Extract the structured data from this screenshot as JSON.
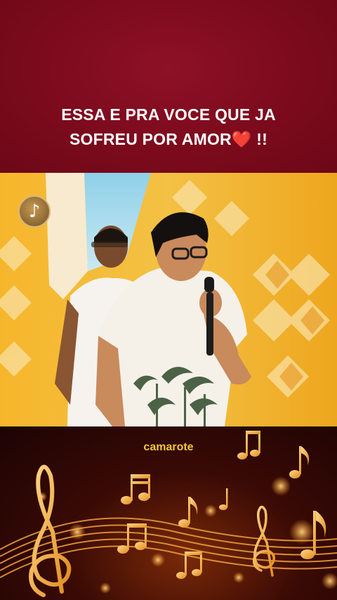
{
  "overlay": {
    "headline_line1": "ESSA E PRA VOCE QUE JA",
    "headline_line2_prefix": "SOFREU POR AMOR",
    "headline_heart": "❤️",
    "headline_line2_suffix": " !!",
    "music_icon": "♪"
  },
  "footer": {
    "caption": "camarote"
  },
  "colors": {
    "banner": "#7d0a1c",
    "video_background": "#f3b42a",
    "caption": "#f2c63a"
  }
}
